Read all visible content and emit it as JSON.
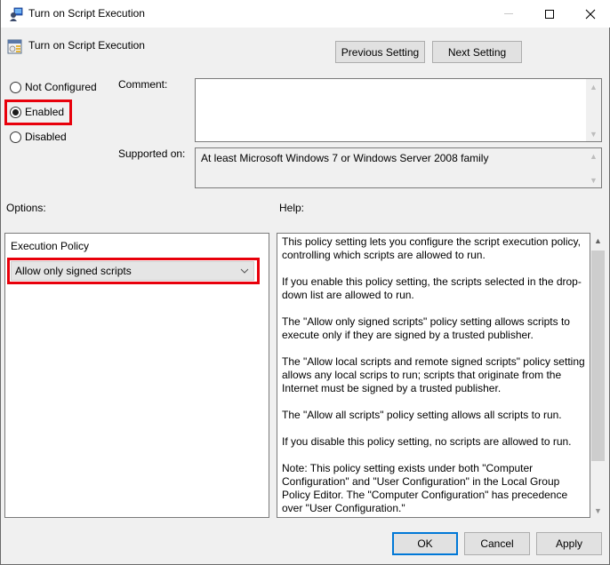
{
  "window": {
    "title": "Turn on Script Execution",
    "controls": {
      "minimize": "minimize",
      "maximize": "maximize",
      "close": "close"
    }
  },
  "header": {
    "policy_title": "Turn on Script Execution",
    "previous_label": "Previous Setting",
    "next_label": "Next Setting"
  },
  "state": {
    "options": [
      {
        "label": "Not Configured",
        "selected": false
      },
      {
        "label": "Enabled",
        "selected": true
      },
      {
        "label": "Disabled",
        "selected": false
      }
    ]
  },
  "comment": {
    "label": "Comment:",
    "value": ""
  },
  "supported": {
    "label": "Supported on:",
    "value": "At least Microsoft Windows 7 or Windows Server 2008 family"
  },
  "options_panel": {
    "label": "Options:",
    "execution_policy_label": "Execution Policy",
    "execution_policy_value": "Allow only signed scripts"
  },
  "help_panel": {
    "label": "Help:",
    "paragraphs": [
      "This policy setting lets you configure the script execution policy, controlling which scripts are allowed to run.",
      "If you enable this policy setting, the scripts selected in the drop-down list are allowed to run.",
      "The \"Allow only signed scripts\" policy setting allows scripts to execute only if they are signed by a trusted publisher.",
      "The \"Allow local scripts and remote signed scripts\" policy setting allows any local scrips to run; scripts that originate from the Internet must be signed by a trusted publisher.",
      "The \"Allow all scripts\" policy setting allows all scripts to run.",
      "If you disable this policy setting, no scripts are allowed to run.",
      "Note: This policy setting exists under both \"Computer Configuration\" and \"User Configuration\" in the Local Group Policy Editor. The \"Computer Configuration\" has precedence over \"User Configuration.\""
    ]
  },
  "footer": {
    "ok_label": "OK",
    "cancel_label": "Cancel",
    "apply_label": "Apply"
  },
  "colors": {
    "highlight": "#e8000b",
    "default_button_border": "#0078d7"
  }
}
